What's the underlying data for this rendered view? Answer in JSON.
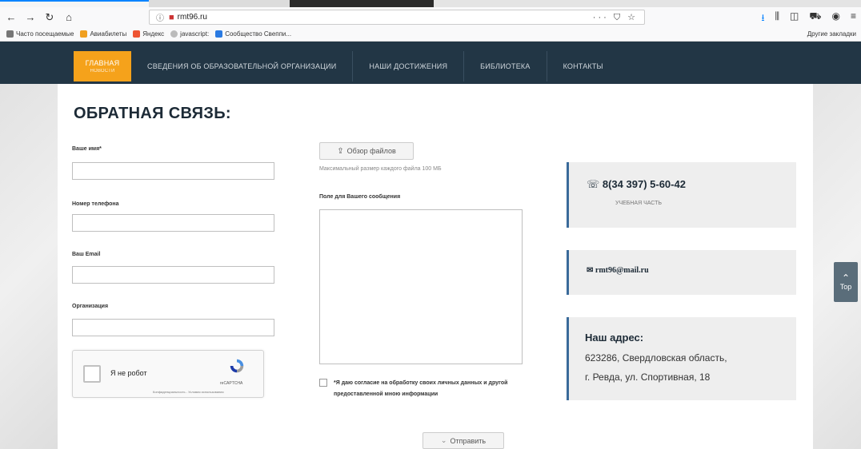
{
  "browser": {
    "url": "rmt96.ru",
    "url_actions": "··· ⛉ ☆",
    "bookmarks": [
      "Часто посещаемые",
      "Авиабилеты",
      "Яндекс",
      "javascript:",
      "Сообщество Свеппи..."
    ],
    "bookmarks_right": "Другие закладки"
  },
  "nav": {
    "items": [
      {
        "label": "ГЛАВНАЯ",
        "sub": "Новости"
      },
      {
        "label": "СВЕДЕНИЯ ОБ ОБРАЗОВАТЕЛЬНОЙ ОРГАНИЗАЦИИ"
      },
      {
        "label": "НАШИ ДОСТИЖЕНИЯ"
      },
      {
        "label": "БИБЛИОТЕКА"
      },
      {
        "label": "КОНТАКТЫ"
      }
    ]
  },
  "form": {
    "title": "ОБРАТНАЯ СВЯЗЬ:",
    "name_label": "Ваше имя*",
    "phone_label": "Номер телефона",
    "email_label": "Ваш Email",
    "org_label": "Организация",
    "file_button": "Обзор файлов",
    "file_note": "Максимальный размер каждого файла 100 МБ",
    "message_label": "Поле для Вашего сообщения",
    "consent": "*Я даю согласие на обработку своих личных данных и другой предоставленной мною информации",
    "send_button": "Отправить"
  },
  "captcha": {
    "label": "Я не робот",
    "brand": "reCAPTCHA",
    "terms": "Конфиденциальность - Условия использования"
  },
  "contacts": {
    "phone": "8(34 397) 5-60-42",
    "phone_caption": "УЧЕБНАЯ ЧАСТЬ",
    "email": "rmt96@mail.ru",
    "address_title": "Наш адрес:",
    "address_line1": "623286, Свердловская область,",
    "address_line2": "г. Ревда, ул. Спортивная, 18"
  },
  "top_button": "Top",
  "colors": {
    "nav_bg": "#223645",
    "nav_active": "#f5a21b",
    "card_accent": "#3a6a9a"
  }
}
